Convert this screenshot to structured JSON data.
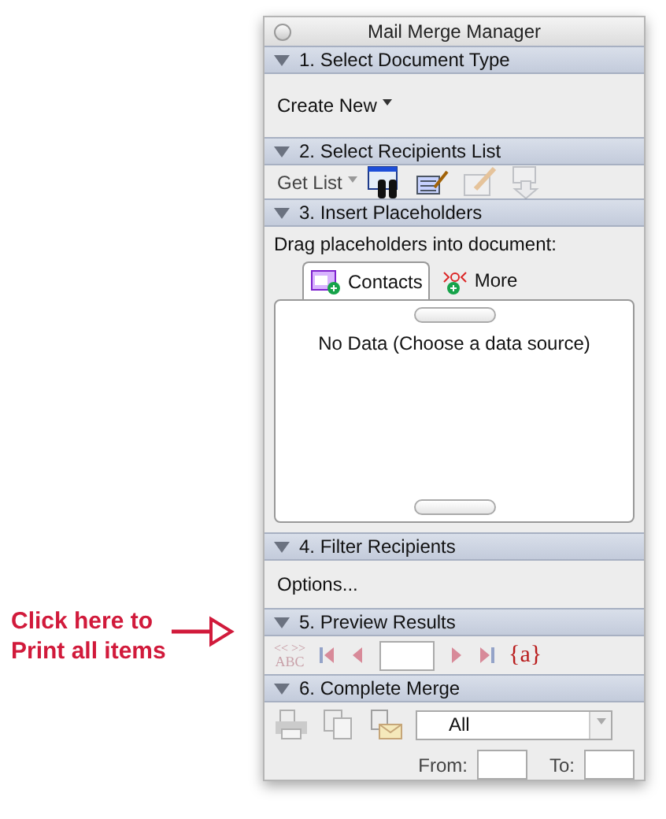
{
  "annotation": {
    "lines": [
      "Click here to",
      "Print all items"
    ]
  },
  "window": {
    "title": "Mail Merge Manager"
  },
  "sections": [
    {
      "kind": "document",
      "title": "1. Select Document Type",
      "expanded": true,
      "menu": "Create New"
    },
    {
      "kind": "recipients",
      "title": "2. Select Recipients List",
      "expanded": true,
      "menu": "Get List",
      "tools": [
        {
          "kind": "binoculars",
          "disabled": false
        },
        {
          "kind": "list-edit",
          "disabled": false
        },
        {
          "kind": "pencil",
          "disabled": true
        },
        {
          "kind": "arrow",
          "disabled": true
        }
      ]
    },
    {
      "kind": "placeholders",
      "title": "3. Insert Placeholders",
      "expanded": true,
      "hint": "Drag placeholders into document:",
      "tabs": [
        {
          "kind": "contacts",
          "label": "Contacts",
          "selected": true
        },
        {
          "kind": "more",
          "label": "More",
          "selected": false
        }
      ],
      "empty": "No Data (Choose a data source)"
    },
    {
      "kind": "filter",
      "title": "4. Filter Recipients",
      "expanded": true,
      "link": "Options..."
    },
    {
      "kind": "preview",
      "title": "5. Preview Results",
      "expanded": true,
      "abc": {
        "marks": "<< >>",
        "label": "ABC",
        "disabled": true
      },
      "braces": "{a}"
    },
    {
      "kind": "merge",
      "title": "6. Complete Merge",
      "expanded": true,
      "select": "All",
      "from_label": "From:",
      "to_label": "To:"
    }
  ]
}
